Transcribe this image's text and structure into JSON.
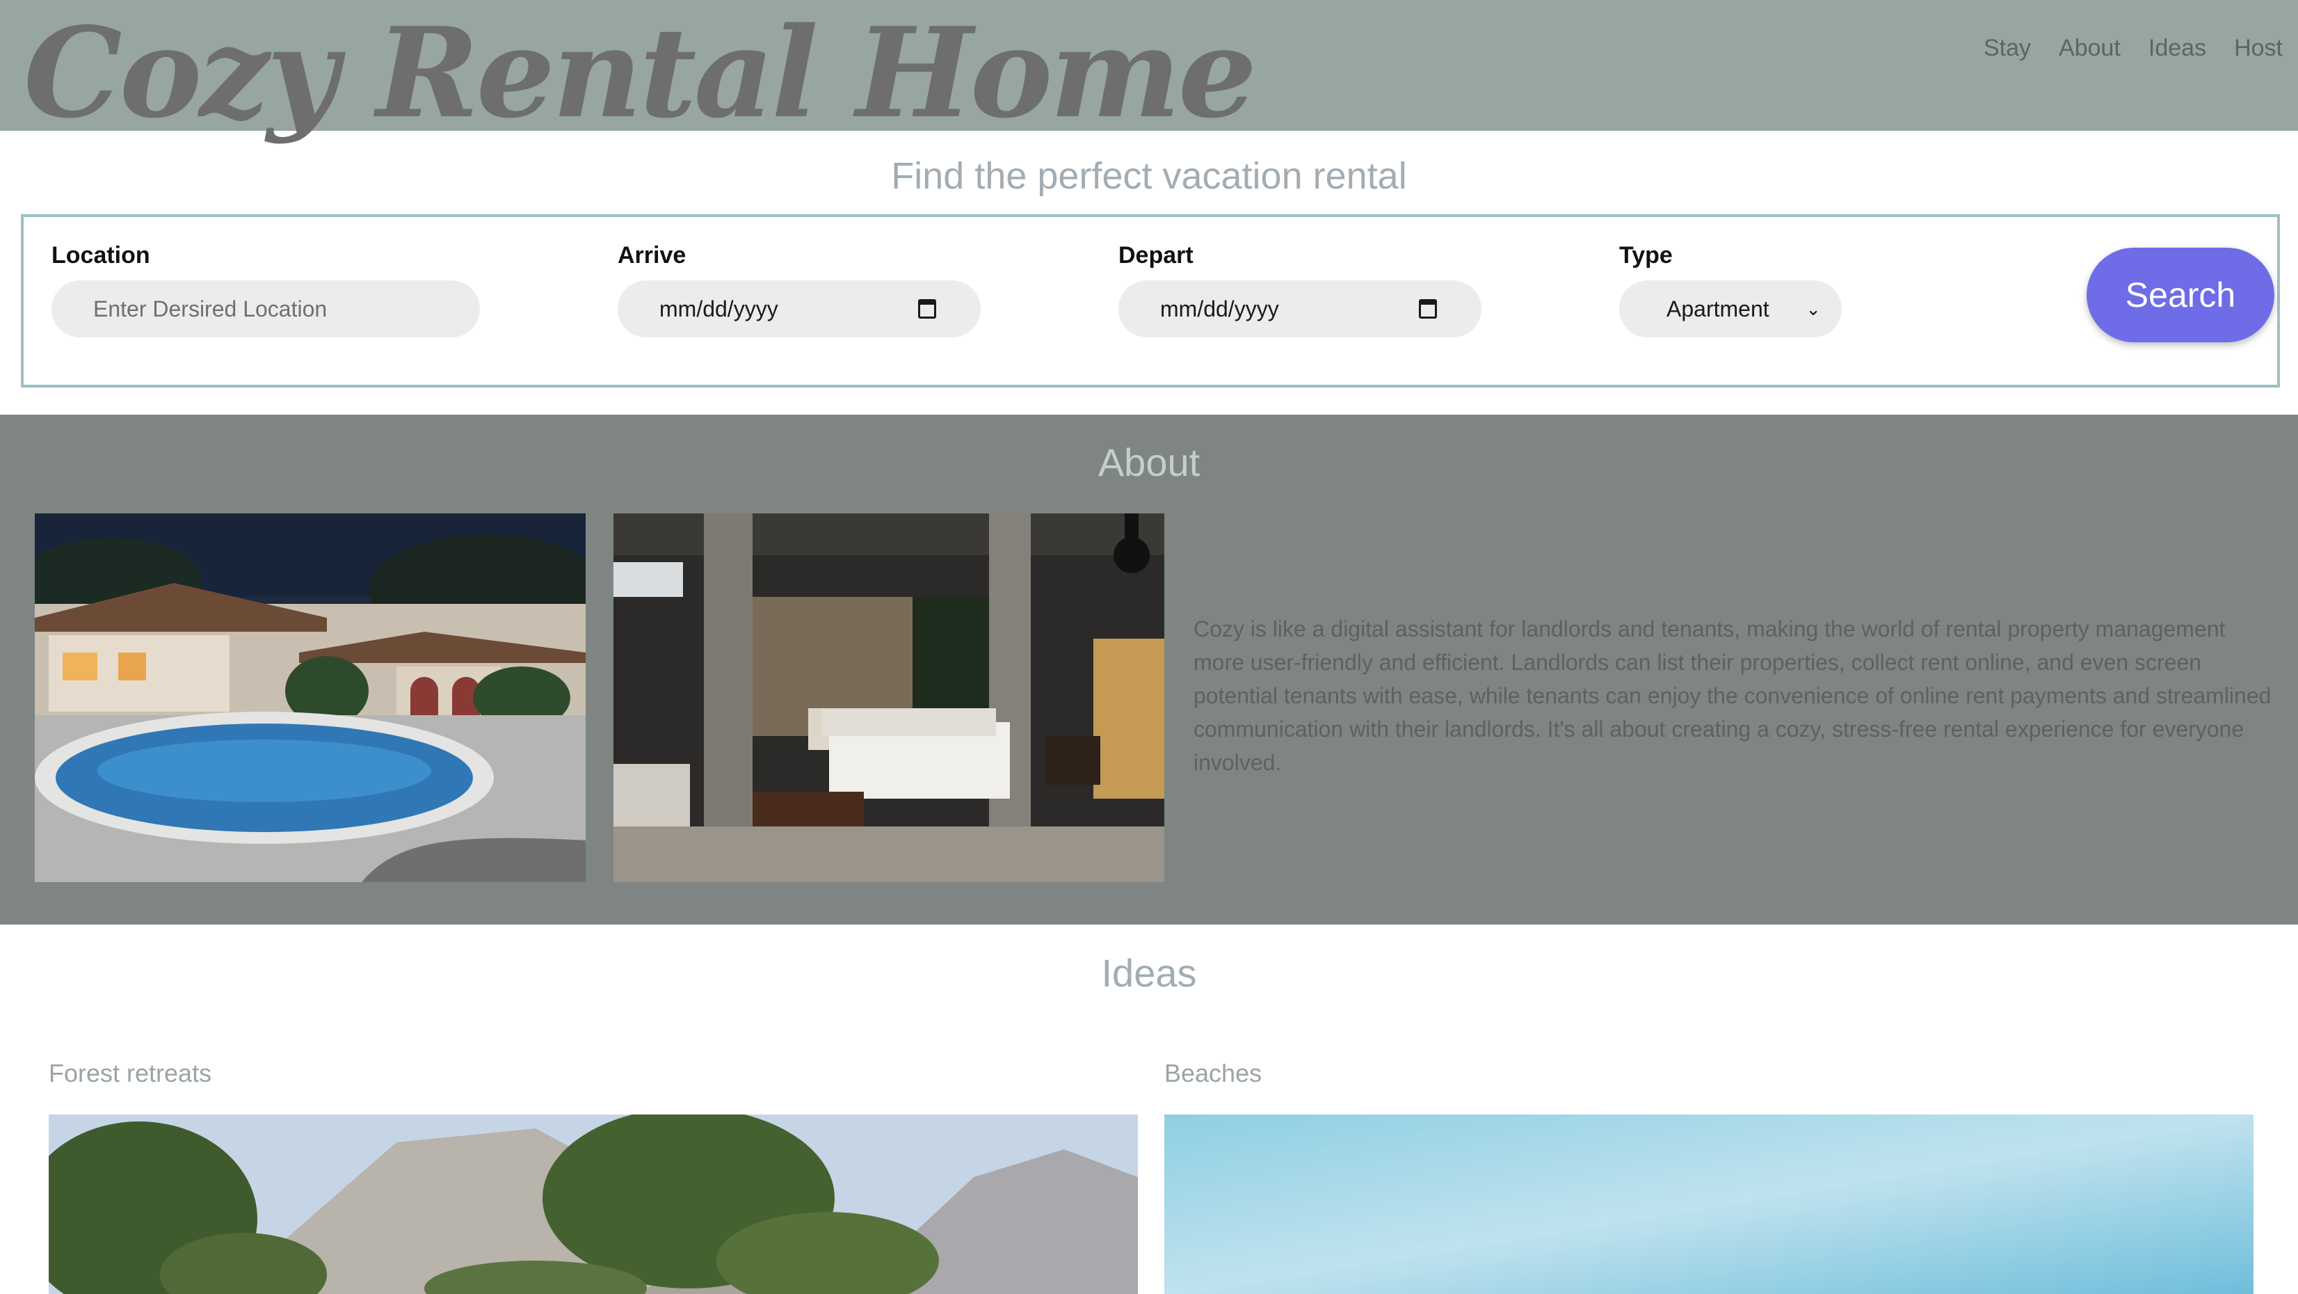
{
  "header": {
    "logo": "Cozy Rental Home",
    "nav": [
      "Stay",
      "About",
      "Ideas",
      "Host"
    ]
  },
  "hero": {
    "title": "Find the perfect vacation rental",
    "location": {
      "label": "Location",
      "placeholder": "Enter Dersired Location"
    },
    "arrive": {
      "label": "Arrive",
      "value": "mm/dd/yyyy"
    },
    "depart": {
      "label": "Depart",
      "value": "mm/dd/yyyy"
    },
    "type": {
      "label": "Type",
      "value": "Apartment"
    },
    "search_label": "Search"
  },
  "about": {
    "title": "About",
    "text": "Cozy is like a digital assistant for landlords and tenants, making the world of rental property management more user-friendly and efficient. Landlords can list their properties, collect rent online, and even screen potential tenants with ease, while tenants can enjoy the convenience of online rent payments and streamlined communication with their landlords. It's all about creating a cozy, stress-free rental experience for everyone involved."
  },
  "ideas": {
    "title": "Ideas",
    "items": [
      {
        "label": "Forest retreats"
      },
      {
        "label": "Beaches"
      }
    ]
  },
  "colors": {
    "header_bg": "#97a6a2",
    "about_bg": "#7f8583",
    "accent": "#6f6ce8",
    "search_border": "#9dc0c3"
  }
}
